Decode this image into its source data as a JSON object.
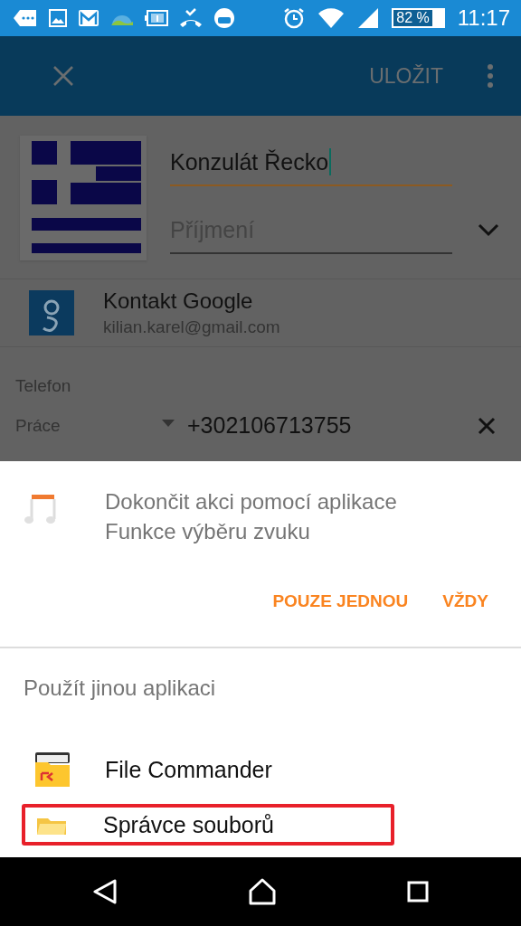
{
  "status_bar": {
    "battery": "82 %",
    "time": "11:17"
  },
  "app_bar": {
    "save": "ULOŽIT"
  },
  "contact": {
    "first_name": "Konzulát Řecko",
    "last_name_placeholder": "Příjmení",
    "account_title": "Kontakt Google",
    "account_email": "kilian.karel@gmail.com"
  },
  "phone": {
    "section": "Telefon",
    "type": "Práce",
    "number": "+302106713755"
  },
  "chooser": {
    "title_lines": [
      "Dokončit akci pomocí aplikace",
      "Funkce výběru zvuku"
    ],
    "buttons": [
      "POUZE JEDNOU",
      "VŽDY"
    ],
    "other_heading": "Použít jinou aplikaci",
    "apps": [
      {
        "name": "File Commander",
        "kind": "file-commander",
        "highlighted": false
      },
      {
        "name": "Správce souborů",
        "kind": "folder",
        "highlighted": true
      }
    ]
  }
}
